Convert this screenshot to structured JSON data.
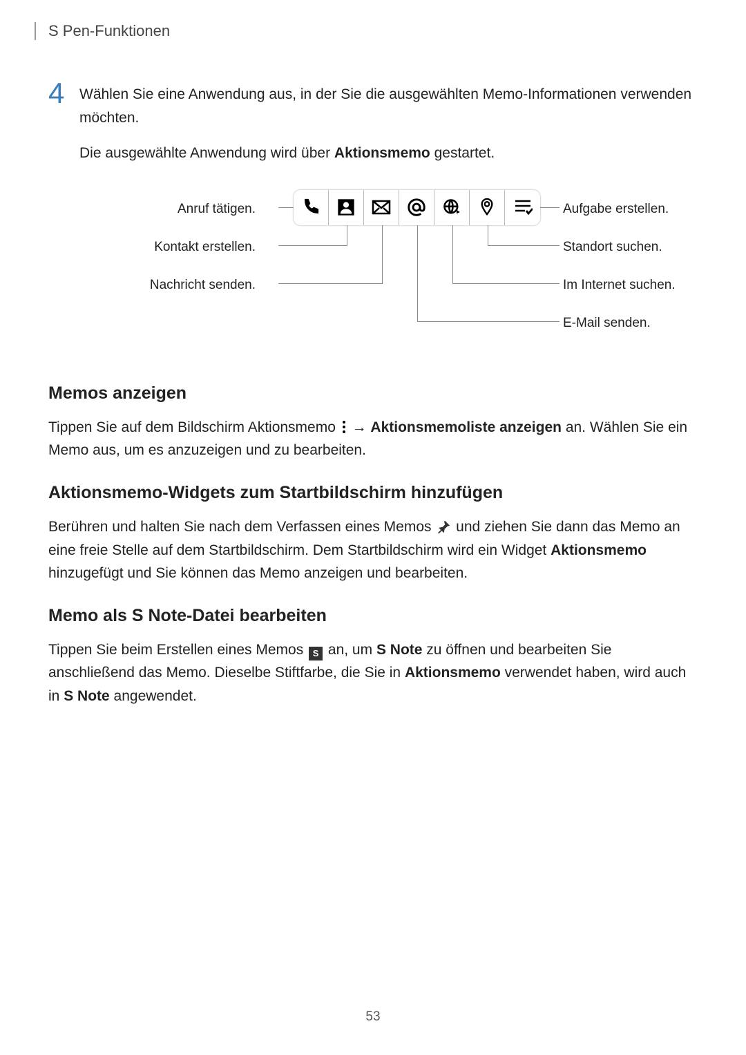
{
  "header": {
    "title": "S Pen-Funktionen"
  },
  "step": {
    "number": "4",
    "para1": "Wählen Sie eine Anwendung aus, in der Sie die ausgewählten Memo-Informationen verwenden möchten.",
    "para2_pre": "Die ausgewählte Anwendung wird über ",
    "para2_bold": "Aktionsmemo",
    "para2_post": " gestartet."
  },
  "diagram": {
    "left": {
      "call": "Anruf tätigen.",
      "contact": "Kontakt erstellen.",
      "message": "Nachricht senden."
    },
    "right": {
      "task": "Aufgabe erstellen.",
      "location": "Standort suchen.",
      "internet": "Im Internet suchen.",
      "email": "E-Mail senden."
    }
  },
  "sections": {
    "memos_title": "Memos anzeigen",
    "memos_p_pre": "Tippen Sie auf dem Bildschirm Aktionsmemo ",
    "memos_p_arrow": " → ",
    "memos_p_bold": "Aktionsmemoliste anzeigen",
    "memos_p_post": " an. Wählen Sie ein Memo aus, um es anzuzeigen und zu bearbeiten.",
    "widgets_title": "Aktionsmemo-Widgets zum Startbildschirm hinzufügen",
    "widgets_p_pre": "Berühren und halten Sie nach dem Verfassen eines Memos ",
    "widgets_p_post1": " und ziehen Sie dann das Memo an eine freie Stelle auf dem Startbildschirm. Dem Startbildschirm wird ein Widget ",
    "widgets_p_bold": "Aktionsmemo",
    "widgets_p_post2": " hinzugefügt und Sie können das Memo anzeigen und bearbeiten.",
    "snote_title": "Memo als S Note-Datei bearbeiten",
    "snote_p_pre": "Tippen Sie beim Erstellen eines Memos ",
    "snote_p_mid1": " an, um ",
    "snote_p_b1": "S Note",
    "snote_p_mid2": " zu öffnen und bearbeiten Sie anschließend das Memo. Dieselbe Stiftfarbe, die Sie in ",
    "snote_p_b2": "Aktionsmemo",
    "snote_p_mid3": " verwendet haben, wird auch in ",
    "snote_p_b3": "S Note",
    "snote_p_post": " angewendet."
  },
  "page_number": "53"
}
